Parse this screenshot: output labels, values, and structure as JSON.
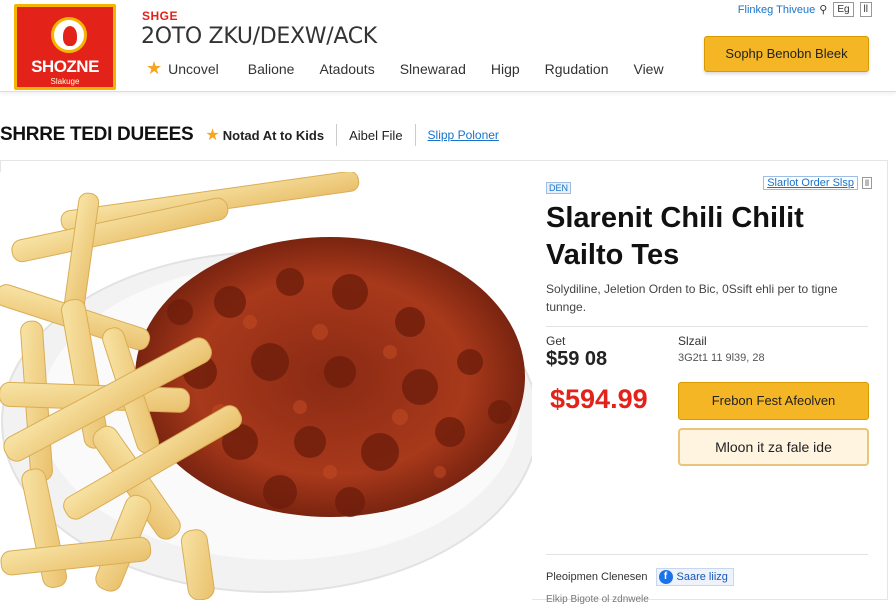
{
  "brand": {
    "logo_text": "SHOZNE",
    "logo_sub": "Slakuge",
    "tag": "SHGE",
    "site_title": "2OTO ZKU/DEXW/ACK"
  },
  "nav": {
    "items": [
      "Uncovel",
      "Balione",
      "Atadouts",
      "Slnewarad",
      "Higp",
      "Rgudation",
      "View"
    ]
  },
  "toplinks": {
    "text": "Flinkeg Thiveue",
    "search_icon": "search-icon",
    "box1": "Eg",
    "box2": "ll"
  },
  "header_button": "Sophp Benobn Bleek",
  "subbar": {
    "title": "SHRRE TEDI DUEEES",
    "rated": "Notad At to Kids",
    "file": "Aibel File",
    "link": "Slipp Poloner"
  },
  "product": {
    "badge": "DEN",
    "order_link": "Slarlot Order Slsp",
    "order_box": "ll",
    "title_line1": "Slarenit Chili Chilit",
    "title_line2": "Vailto Tes",
    "description": "Solydiline, Jeletion Orden to Bic, 0Ssift ehli per to tigne tunnge.",
    "get_label": "Get",
    "get_value": "$59 08",
    "size_label": "Slzail",
    "size_value": "3G2t1 11 9l39, 28",
    "price": "$594.99",
    "btn_primary": "Frebon Fest Afeolven",
    "btn_secondary": "Mloon it za fale ide",
    "share_label": "Pleoipmen Clenesen",
    "share_button": "Saare liizg",
    "footer": "Elkip Bigote ol zdnwele"
  },
  "colors": {
    "brand_red": "#e32219",
    "accent_yellow": "#f5b625",
    "link_blue": "#1a73c8"
  }
}
